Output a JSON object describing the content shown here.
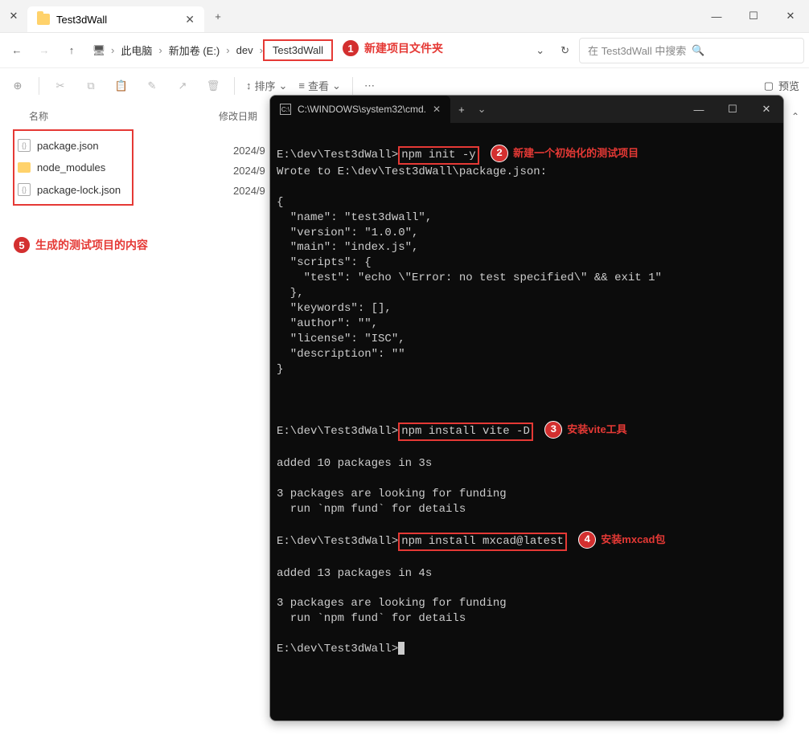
{
  "explorer": {
    "tab_title": "Test3dWall",
    "breadcrumb": {
      "pc": "此电脑",
      "drive": "新加卷 (E:)",
      "dev": "dev",
      "folder": "Test3dWall"
    },
    "search_placeholder": "在 Test3dWall 中搜索",
    "toolbar": {
      "sort": "排序",
      "view": "查看",
      "preview": "预览"
    },
    "columns": {
      "name": "名称",
      "modified": "修改日期"
    },
    "files": [
      {
        "name": "package.json",
        "type": "json",
        "date": "2024/9"
      },
      {
        "name": "node_modules",
        "type": "folder",
        "date": "2024/9"
      },
      {
        "name": "package-lock.json",
        "type": "json",
        "date": "2024/9"
      }
    ]
  },
  "annotations": {
    "a1": {
      "num": "1",
      "text": "新建项目文件夹"
    },
    "a2": {
      "num": "2",
      "text": "新建一个初始化的测试项目"
    },
    "a3": {
      "num": "3",
      "text": "安装vite工具"
    },
    "a4": {
      "num": "4",
      "text": "安装mxcad包"
    },
    "a5": {
      "num": "5",
      "text": "生成的测试项目的内容"
    }
  },
  "terminal": {
    "title": "C:\\WINDOWS\\system32\\cmd.",
    "prompt": "E:\\dev\\Test3dWall>",
    "cmd1": "npm init -y",
    "out1_l1": "Wrote to E:\\dev\\Test3dWall\\package.json:",
    "json_block": "{\n  \"name\": \"test3dwall\",\n  \"version\": \"1.0.0\",\n  \"main\": \"index.js\",\n  \"scripts\": {\n    \"test\": \"echo \\\"Error: no test specified\\\" && exit 1\"\n  },\n  \"keywords\": [],\n  \"author\": \"\",\n  \"license\": \"ISC\",\n  \"description\": \"\"\n}",
    "cmd2": "npm install vite -D",
    "out2_l1": "added 10 packages in 3s",
    "out2_l2": "3 packages are looking for funding",
    "out2_l3": "  run `npm fund` for details",
    "cmd3": "npm install mxcad@latest",
    "out3_l1": "added 13 packages in 4s",
    "out3_l2": "3 packages are looking for funding",
    "out3_l3": "  run `npm fund` for details"
  }
}
